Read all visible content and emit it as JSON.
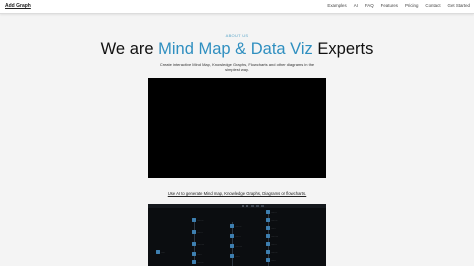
{
  "header": {
    "brand": "Add Graph",
    "nav": [
      "Examples",
      "AI",
      "FAQ",
      "Features",
      "Pricing",
      "Contact",
      "Get Started"
    ]
  },
  "hero": {
    "eyebrow": "ABOUT US",
    "title_prefix": "We are ",
    "title_accent": "Mind Map & Data Viz",
    "title_suffix": " Experts",
    "subtitle": "Create interactive Mind Map, Knowledge Graphs, Flowcharts and other diagrams in the simplest way."
  },
  "cta": {
    "link_text": "Use AI to generate Mind map, Knowledge Graphs, Diagrams or flowcharts."
  },
  "colors": {
    "accent": "#2f8fc0",
    "eyebrow": "#5aa6c9",
    "background": "#f4f4f4",
    "video_bg": "#000000",
    "demo_bg": "#0b0d10",
    "node": "#3e7fb0"
  }
}
